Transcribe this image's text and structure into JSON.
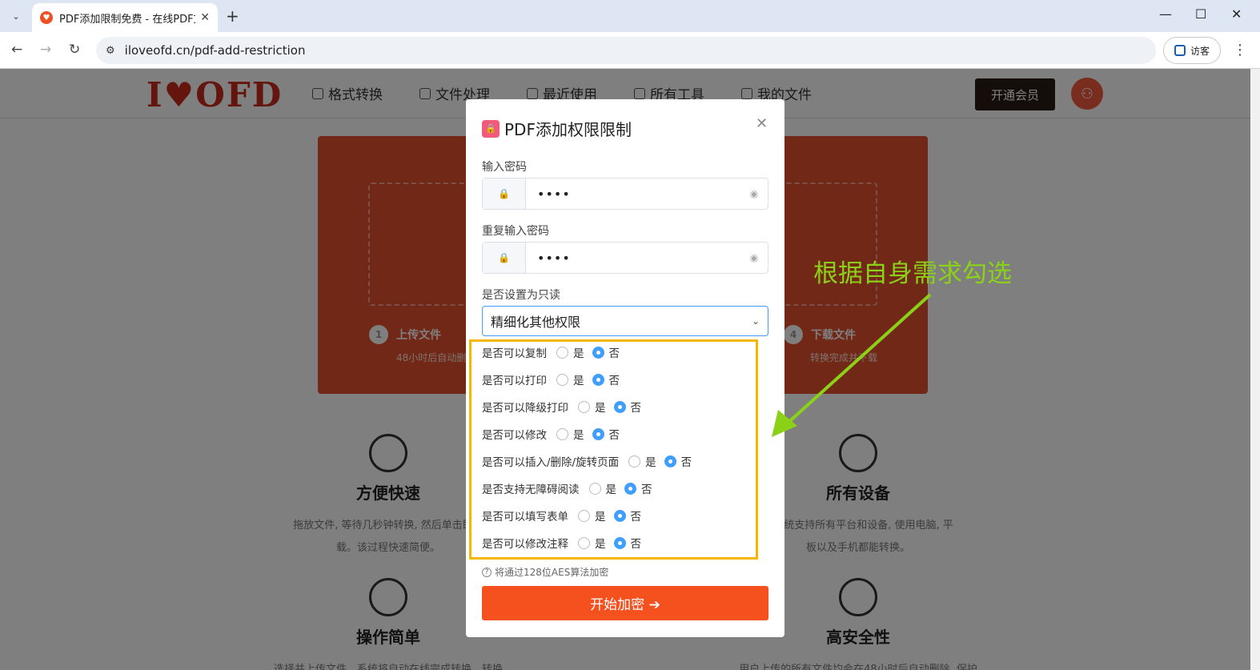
{
  "browser": {
    "tab_title": "PDF添加限制免费 - 在线PDF文",
    "url": "iloveofd.cn/pdf-add-restriction",
    "visitor_label": "访客"
  },
  "site": {
    "logo": "I♥OFD",
    "nav": [
      "格式转换",
      "文件处理",
      "最近使用",
      "所有工具",
      "我的文件"
    ],
    "vip_button": "开通会员",
    "steps": [
      {
        "num": "1",
        "label": "上传文件",
        "sub": "48小时后自动删"
      },
      {
        "num": "4",
        "label": "下载文件",
        "sub": "转换完成并下载"
      }
    ],
    "features": [
      {
        "title": "方便快速",
        "desc": "拖放文件, 等待几秒钟转换, 然后单击即可",
        "desc2": "载。该过程快速简便。"
      },
      {
        "title": "所有设备",
        "desc": "，系统支持所有平台和设备, 使用电脑, 平",
        "desc2": "板以及手机都能转换。"
      },
      {
        "title": "操作简单",
        "desc": "选择并上传文件，系统将自动在线完成转换，转换",
        "desc2": ""
      },
      {
        "title": "高安全性",
        "desc": "用户上传的所有文件均会在48小时后自动删除, 保护",
        "desc2": ""
      }
    ]
  },
  "modal": {
    "title": "PDF添加权限限制",
    "password_label": "输入密码",
    "password_value": "••••",
    "repeat_label": "重复输入密码",
    "repeat_value": "••••",
    "readonly_label": "是否设置为只读",
    "readonly_selected": "精细化其他权限",
    "yes": "是",
    "no": "否",
    "permissions": [
      {
        "label": "是否可以复制",
        "value": "否"
      },
      {
        "label": "是否可以打印",
        "value": "否"
      },
      {
        "label": "是否可以降级打印",
        "value": "否"
      },
      {
        "label": "是否可以修改",
        "value": "否"
      },
      {
        "label": "是否可以插入/删除/旋转页面",
        "value": "否"
      },
      {
        "label": "是否支持无障碍阅读",
        "value": "否"
      },
      {
        "label": "是否可以填写表单",
        "value": "否"
      },
      {
        "label": "是否可以修改注释",
        "value": "否"
      }
    ],
    "aes_note": "将通过128位AES算法加密",
    "start_button": "开始加密 ➔"
  },
  "annotation": {
    "text": "根据自身需求勾选",
    "color": "#8bd118",
    "highlight_color": "#f5b800"
  }
}
